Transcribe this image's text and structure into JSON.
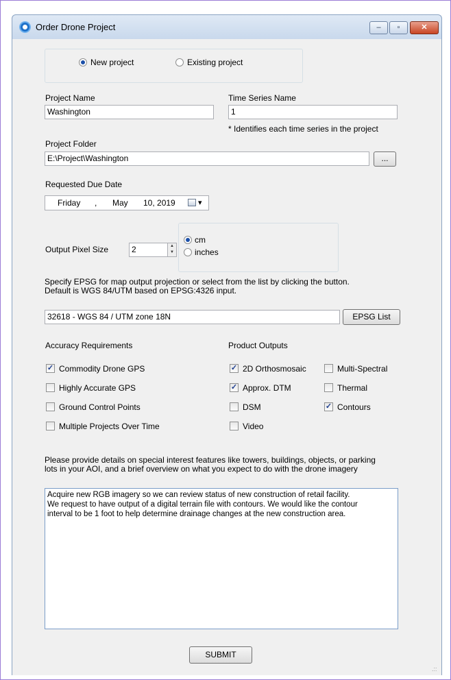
{
  "window": {
    "title": "Order Drone Project",
    "minimize_glyph": "–",
    "maximize_glyph": "▫",
    "close_glyph": "✕"
  },
  "project_type": {
    "new_label": "New project",
    "existing_label": "Existing project",
    "selected": "new"
  },
  "project_name": {
    "label": "Project Name",
    "value": "Washington"
  },
  "time_series": {
    "label": "Time Series Name",
    "value": "1",
    "note": "* Identifies each time series in the project"
  },
  "project_folder": {
    "label": "Project Folder",
    "value": "E:\\Project\\Washington",
    "browse_label": "..."
  },
  "due_date": {
    "label": "Requested Due Date",
    "day": "Friday",
    "sep": ",",
    "month": "May",
    "date": "10, 2019"
  },
  "pixel_size": {
    "label": "Output Pixel Size",
    "value": "2",
    "unit_cm": "cm",
    "unit_inches": "inches",
    "selected_unit": "cm"
  },
  "epsg": {
    "instructions_line1": "Specify EPSG for map output projection or select from the list by clicking the button.",
    "instructions_line2": "Default is WGS 84/UTM based on EPSG:4326 input.",
    "value": "32618 - WGS 84 / UTM zone 18N",
    "button_label": "EPSG List"
  },
  "accuracy": {
    "heading": "Accuracy Requirements",
    "items": [
      {
        "label": "Commodity Drone GPS",
        "checked": true
      },
      {
        "label": "Highly Accurate GPS",
        "checked": false
      },
      {
        "label": "Ground Control Points",
        "checked": false
      },
      {
        "label": "Multiple Projects Over Time",
        "checked": false
      }
    ]
  },
  "outputs": {
    "heading": "Product Outputs",
    "col1": [
      {
        "label": "2D Orthosmosaic",
        "checked": true
      },
      {
        "label": "Approx. DTM",
        "checked": true
      },
      {
        "label": "DSM",
        "checked": false
      },
      {
        "label": "Video",
        "checked": false
      }
    ],
    "col2": [
      {
        "label": "Multi-Spectral",
        "checked": false
      },
      {
        "label": "Thermal",
        "checked": false
      },
      {
        "label": "Contours",
        "checked": true
      }
    ]
  },
  "details": {
    "prompt_line1": "Please provide details on special interest features like towers, buildings, objects, or parking",
    "prompt_line2": "lots in your AOI, and a brief overview on what you expect to do with the drone imagery",
    "text_line1": "Acquire new RGB imagery so we can review status of new construction of retail facility.",
    "text_line2": "We request to have output of a digital terrain file with contours.  We would like the contour",
    "text_line3": "interval to be 1 foot to help determine drainage changes at the new construction area."
  },
  "submit_label": "SUBMIT",
  "check_glyph": "✓",
  "icons": {
    "app": "app-icon",
    "calendar": "calendar-icon",
    "spin_up": "▲",
    "spin_down": "▼",
    "dropdown": "▾",
    "grip": ".::"
  }
}
